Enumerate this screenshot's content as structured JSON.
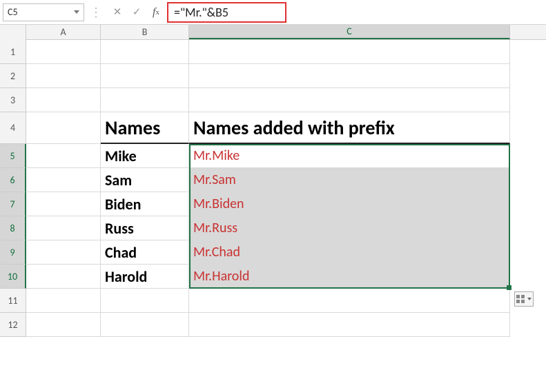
{
  "namebox": {
    "value": "C5"
  },
  "formula_bar": {
    "formula": "=\"Mr.\"&B5"
  },
  "columns": [
    "A",
    "B",
    "C"
  ],
  "rows": [
    "1",
    "2",
    "3",
    "4",
    "5",
    "6",
    "7",
    "8",
    "9",
    "10",
    "11",
    "12"
  ],
  "headers": {
    "B": "Names",
    "C": "Names added with prefix"
  },
  "data": {
    "names": [
      "Mike",
      "Sam",
      "Biden",
      "Russ",
      "Chad",
      "Harold"
    ],
    "prefixed": [
      "Mr.Mike",
      "Mr.Sam",
      "Mr.Biden",
      "Mr.Russ",
      "Mr.Chad",
      "Mr.Harold"
    ]
  },
  "selection": {
    "active_cell": "C5",
    "range": "C5:C10"
  }
}
